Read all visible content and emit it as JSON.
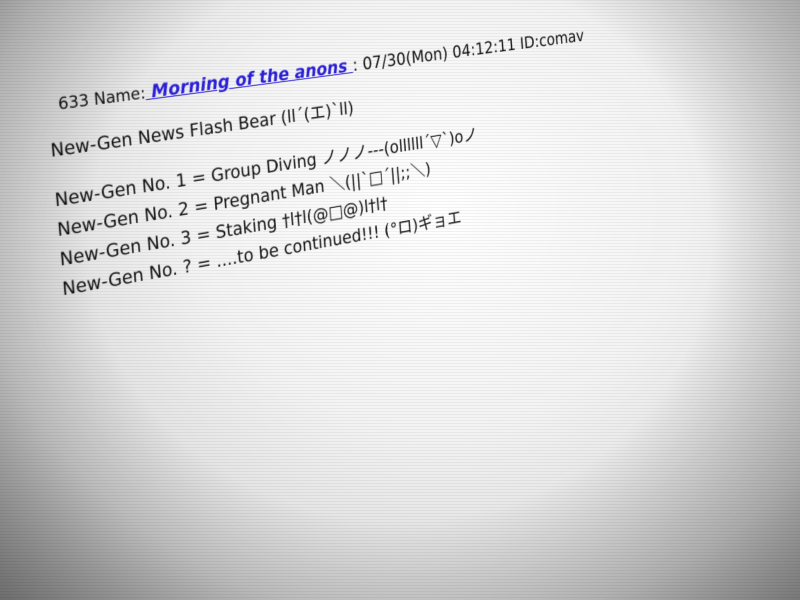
{
  "post": {
    "number": "633",
    "name_label": "Name:",
    "name_link": " Morning of the anons ",
    "date_meta": ": 07/30(Mon) 04:12:11 ID:comav",
    "body": {
      "title_line": "New-Gen News Flash Bear (ll´(エ)`ll)",
      "lines": [
        "New-Gen No. 1 = Group Diving ノノノ---(ollllll´▽`)oノ",
        "New-Gen No. 2 = Pregnant Man ＼(||`□´||;;＼)",
        "New-Gen No. 3 = Staking †l†l(@□@)l†l†",
        "New-Gen No. ? = ....to be continued!!! (°ロ)ギョエ"
      ]
    }
  }
}
